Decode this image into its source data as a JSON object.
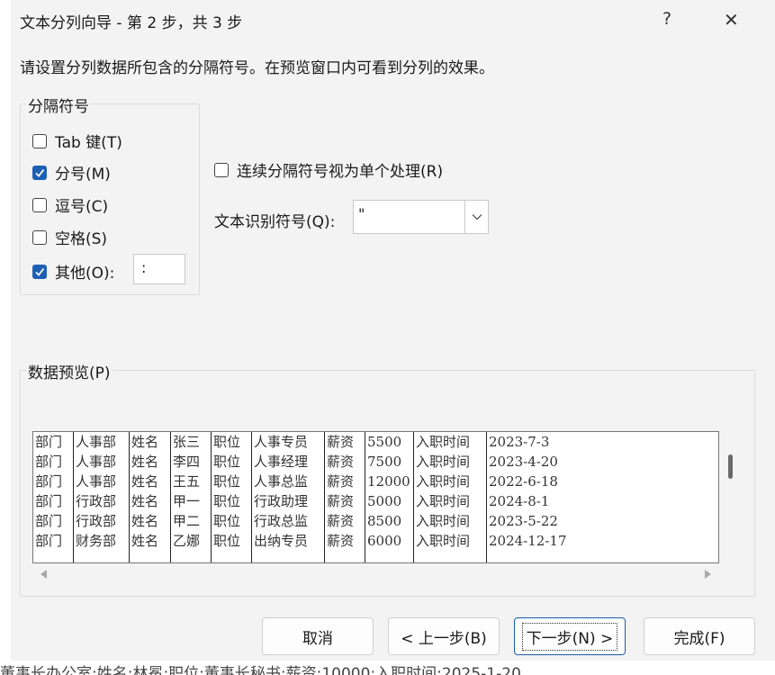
{
  "dialog": {
    "title": "文本分列向导 - 第 2 步，共 3 步",
    "help": "?",
    "close": "✕",
    "instruction": "请设置分列数据所包含的分隔符号。在预览窗口内可看到分列的效果。"
  },
  "delimiters": {
    "group_label": "分隔符号",
    "tab": {
      "label": "Tab 键(T)",
      "checked": false
    },
    "semicolon": {
      "label": "分号(M)",
      "checked": true
    },
    "comma": {
      "label": "逗号(C)",
      "checked": false
    },
    "space": {
      "label": "空格(S)",
      "checked": false
    },
    "other": {
      "label": "其他(O):",
      "checked": true,
      "value": ":"
    }
  },
  "consecutive": {
    "label": "连续分隔符号视为单个处理(R)",
    "checked": false
  },
  "text_qualifier": {
    "label": "文本识别符号(Q):",
    "value": "\""
  },
  "preview": {
    "label": "数据预览(P)",
    "rows": [
      [
        "部门",
        "人事部",
        "姓名",
        "张三",
        "职位",
        "人事专员",
        "薪资",
        "5500",
        "入职时间",
        "2023-7-3"
      ],
      [
        "部门",
        "人事部",
        "姓名",
        "李四",
        "职位",
        "人事经理",
        "薪资",
        "7500",
        "入职时间",
        "2023-4-20"
      ],
      [
        "部门",
        "人事部",
        "姓名",
        "王五",
        "职位",
        "人事总监",
        "薪资",
        "12000",
        "入职时间",
        "2022-6-18"
      ],
      [
        "部门",
        "行政部",
        "姓名",
        "甲一",
        "职位",
        "行政助理",
        "薪资",
        "5000",
        "入职时间",
        "2024-8-1"
      ],
      [
        "部门",
        "行政部",
        "姓名",
        "甲二",
        "职位",
        "行政总监",
        "薪资",
        "8500",
        "入职时间",
        "2023-5-22"
      ],
      [
        "部门",
        "财务部",
        "姓名",
        "乙娜",
        "职位",
        "出纳专员",
        "薪资",
        "6000",
        "入职时间",
        "2024-12-17"
      ]
    ]
  },
  "buttons": {
    "cancel": "取消",
    "back": "< 上一步(B)",
    "next": "下一步(N) >",
    "finish": "完成(F)"
  },
  "background": {
    "bottom_text": "董事长办公室;姓名:林冕;职位:董事长秘书;薪资:10000;入职时间:2025-1-20"
  },
  "colors": {
    "accent": "#1d5fb3"
  }
}
